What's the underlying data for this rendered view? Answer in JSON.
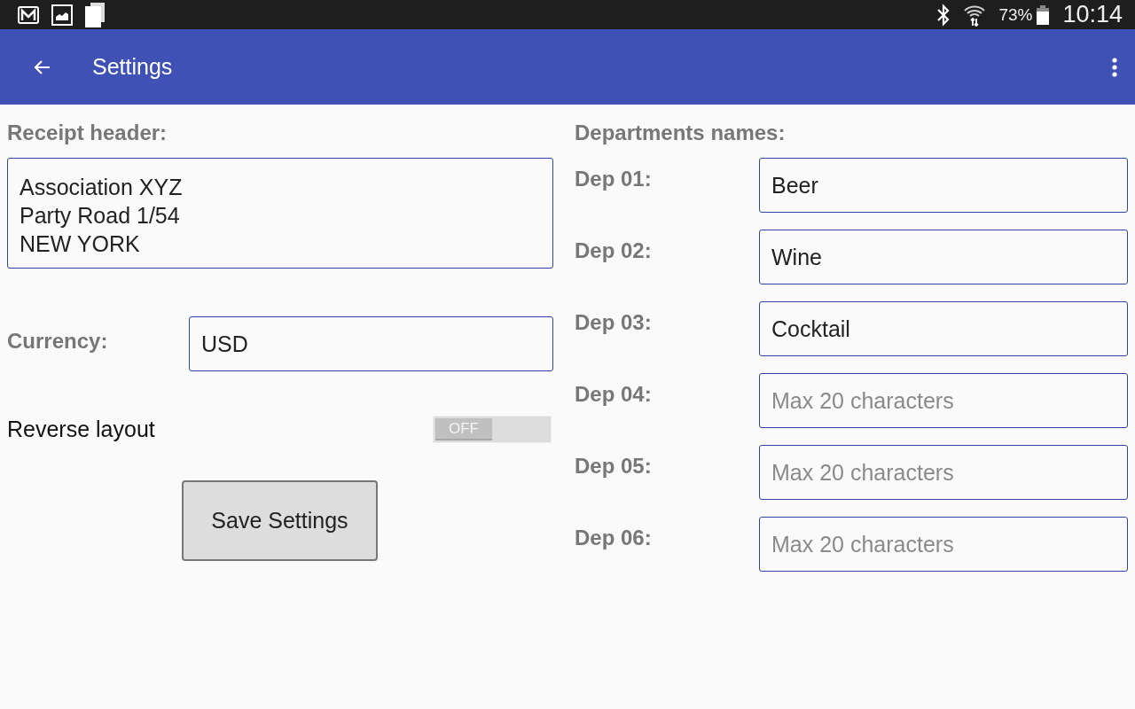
{
  "status_bar": {
    "battery": "73%",
    "time": "10:14"
  },
  "app_bar": {
    "title": "Settings"
  },
  "receipt_header": {
    "label": "Receipt header:",
    "value": "Association XYZ\nParty Road 1/54\nNEW YORK"
  },
  "currency": {
    "label": "Currency:",
    "value": "USD"
  },
  "reverse_layout": {
    "label": "Reverse layout",
    "on": false,
    "toggle_text": "OFF"
  },
  "save_button": "Save Settings",
  "departments": {
    "label": "Departments names:",
    "items": [
      {
        "label": "Dep 01:",
        "value": "Beer"
      },
      {
        "label": "Dep 02:",
        "value": "Wine"
      },
      {
        "label": "Dep 03:",
        "value": "Cocktail"
      },
      {
        "label": "Dep 04:",
        "placeholder": "Max 20 characters"
      },
      {
        "label": "Dep 05:",
        "placeholder": "Max 20 characters"
      },
      {
        "label": "Dep 06:",
        "placeholder": "Max 20 characters"
      }
    ]
  }
}
